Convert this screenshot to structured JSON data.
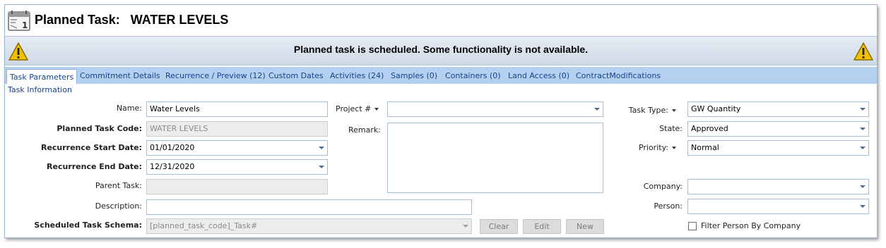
{
  "header": {
    "title": "Planned Task:   WATER LEVELS",
    "icon": "calendar-icon",
    "icon_day": "1"
  },
  "warning": {
    "text": "Planned task is scheduled. Some functionality is not available.",
    "icon": "warning-icon",
    "icon_color": "#f2c200"
  },
  "tabs": [
    {
      "label": "Task Parameters",
      "active": true
    },
    {
      "label": "Commitment Details"
    },
    {
      "label": "Recurrence / Preview (12)"
    },
    {
      "label": "Custom Dates"
    },
    {
      "label": "Activities (24)"
    },
    {
      "label": "Samples (0)"
    },
    {
      "label": "Containers (0)"
    },
    {
      "label": "Land Access (0)"
    },
    {
      "label": "ContractModifications"
    }
  ],
  "section": {
    "label": "Task Information"
  },
  "form": {
    "name": {
      "label": "Name:",
      "value": "Water Levels"
    },
    "planned_task_code": {
      "label": "Planned Task Code:",
      "value": "WATER LEVELS"
    },
    "recurrence_start": {
      "label": "Recurrence Start Date:",
      "value": "01/01/2020"
    },
    "recurrence_end": {
      "label": "Recurrence End Date:",
      "value": "12/31/2020"
    },
    "parent_task": {
      "label": "Parent Task:",
      "value": ""
    },
    "description": {
      "label": "Description:",
      "value": ""
    },
    "schema": {
      "label": "Scheduled Task Schema:",
      "placeholder": "[planned_task_code]_Task#"
    },
    "project": {
      "label": "Project #",
      "value": ""
    },
    "remark": {
      "label": "Remark:",
      "value": ""
    },
    "task_type": {
      "label": "Task Type:",
      "value": "GW Quantity"
    },
    "state": {
      "label": "State:",
      "value": "Approved"
    },
    "priority": {
      "label": "Priority:",
      "value": "Normal"
    },
    "company": {
      "label": "Company:",
      "value": ""
    },
    "person": {
      "label": "Person:",
      "value": ""
    },
    "filter_person": {
      "label": "Filter Person By Company",
      "checked": false
    }
  },
  "buttons": {
    "clear": "Clear",
    "edit": "Edit",
    "new": "New"
  },
  "colors": {
    "tab_bar": "#b4d0f0",
    "tab_text": "#15428b",
    "field_border": "#a7bcd6"
  }
}
